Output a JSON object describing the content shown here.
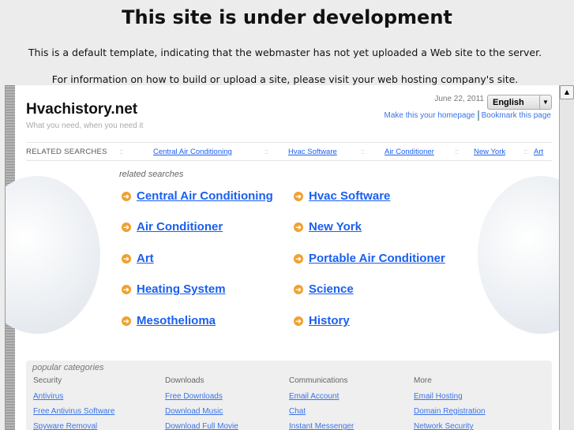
{
  "header": {
    "title": "This site is under development",
    "line1": "This is a default template, indicating that the webmaster has not yet uploaded a Web site to the server.",
    "line2": "For information on how to build or upload a site, please visit your web hosting company's site."
  },
  "site": {
    "name": "Hvachistory.net",
    "tagline": "What you need, when you need it",
    "date": "June 22, 2011",
    "language": "English",
    "homepage_link": "Make this your homepage",
    "bookmark_link": "Bookmark this page"
  },
  "related_bar": {
    "label": "RELATED SEARCHES",
    "sep": "::",
    "links": [
      "Central Air Conditioning",
      "Hvac Software",
      "Air Conditioner",
      "New York",
      "Art"
    ]
  },
  "related": {
    "title": "related searches",
    "links": [
      "Central Air Conditioning",
      "Hvac Software",
      "Air Conditioner",
      "New York",
      "Art",
      "Portable Air Conditioner",
      "Heating System",
      "Science",
      "Mesothelioma",
      "History"
    ]
  },
  "popular": {
    "title": "popular categories",
    "columns": [
      {
        "heading": "Security",
        "links": [
          "Antivirus",
          "Free Antivirus Software",
          "Spyware Removal"
        ]
      },
      {
        "heading": "Downloads",
        "links": [
          "Free Downloads",
          "Download Music",
          "Download Full Movie"
        ]
      },
      {
        "heading": "Communications",
        "links": [
          "Email Account",
          "Chat",
          "Instant Messenger"
        ]
      },
      {
        "heading": "More",
        "links": [
          "Email Hosting",
          "Domain Registration",
          "Network Security"
        ]
      }
    ]
  }
}
